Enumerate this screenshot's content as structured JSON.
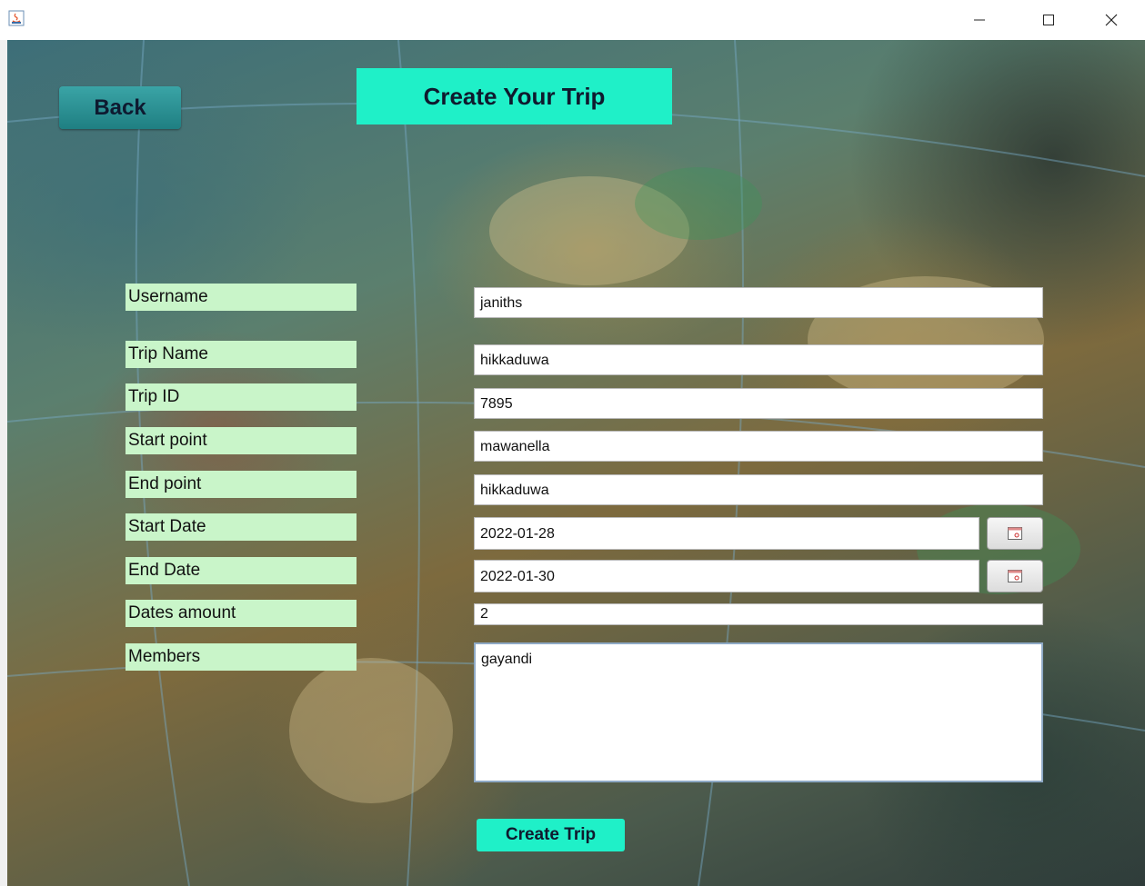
{
  "window": {
    "app_icon": "java-icon",
    "controls": [
      "minimize-icon",
      "maximize-icon",
      "close-icon"
    ]
  },
  "header": {
    "back_label": "Back",
    "title": "Create Your Trip"
  },
  "form": {
    "username": {
      "label": "Username",
      "value": "janiths"
    },
    "trip_name": {
      "label": "Trip Name",
      "value": "hikkaduwa"
    },
    "trip_id": {
      "label": "Trip ID",
      "value": "7895"
    },
    "start_point": {
      "label": "Start point",
      "value": "mawanella"
    },
    "end_point": {
      "label": "End point",
      "value": "hikkaduwa"
    },
    "start_date": {
      "label": "Start Date",
      "value": "2022-01-28"
    },
    "end_date": {
      "label": "End Date",
      "value": "2022-01-30"
    },
    "dates_amount": {
      "label": "Dates amount",
      "value": "2"
    },
    "members": {
      "label": "Members",
      "value": "gayandi"
    }
  },
  "actions": {
    "create_label": "Create Trip"
  },
  "colors": {
    "accent": "#1ff0c8",
    "label_bg": "#c9f5c9",
    "back_button": "#2a9a9c"
  }
}
